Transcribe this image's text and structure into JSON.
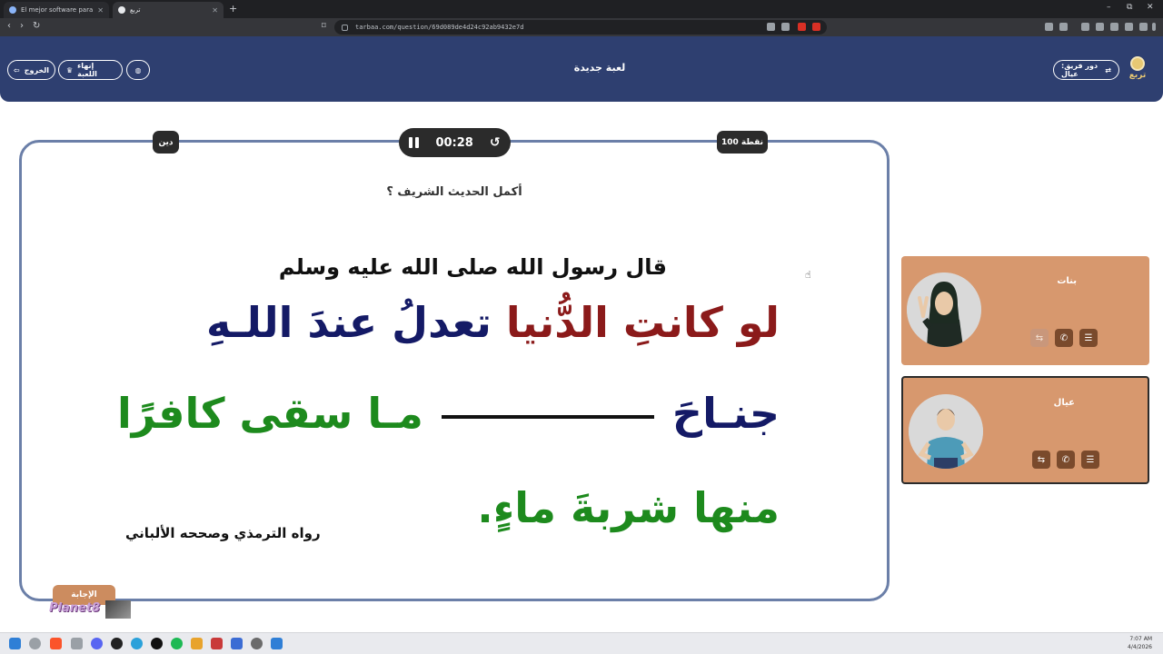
{
  "browser": {
    "tabs": [
      {
        "title": "El mejor software para potencia",
        "active": false
      },
      {
        "title": "تربع",
        "active": true
      }
    ],
    "new_tab_label": "+",
    "window_controls": [
      "–",
      "⧉",
      "✕"
    ],
    "url": "tarbaa.com/question/69d089de4d24c92ab9432e7d"
  },
  "header": {
    "title": "لعبة جديدة",
    "exit_label": "الخروج",
    "end_game_label": "إنهاء اللعبة",
    "team_turn_label": "دور فريق: عيال",
    "logo_text": "تربع"
  },
  "question": {
    "category": "دين",
    "points": "100 نقطة",
    "timer": "00:28",
    "prompt": "أكمل الحديث الشريف ؟",
    "hadith": {
      "intro": "قال رسول الله صلى الله عليه وسلم",
      "line1_red": "لو كانتِ الدُّنيا",
      "line1_navy": "تعدلُ عندَ اللـهِ",
      "line2_navy": "جنـاحَ",
      "line2_green": "مـا سقى كافرًا",
      "line3": "منها شربةَ ماءٍ.",
      "source": "رواه الترمذي وصححه الألباني"
    },
    "answer_label": "الإجابة"
  },
  "teams": [
    {
      "name": "بنات",
      "avatar": "girl-avatar",
      "lifelines": [
        "list-icon",
        "phone-icon",
        "swap-icon"
      ],
      "used": [
        false,
        false,
        true
      ]
    },
    {
      "name": "عيال",
      "avatar": "boy-avatar",
      "lifelines": [
        "list-icon",
        "phone-icon",
        "swap-icon"
      ],
      "used": [
        false,
        false,
        false
      ]
    }
  ],
  "watermark": "Planet8",
  "taskbar": {
    "clock_time": "7:07 AM",
    "clock_date": "4/4/2026"
  },
  "colors": {
    "header_bg": "#2e3f70",
    "card_border": "#6b7fa8",
    "team_bg": "#d7986e",
    "accent_red": "#8b1a1a",
    "accent_navy": "#141a66",
    "accent_green": "#1d8a1d"
  }
}
